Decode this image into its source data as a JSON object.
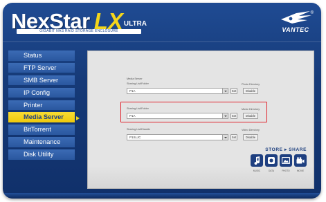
{
  "header": {
    "logo_main": "NexStar",
    "logo_lx": "LX",
    "logo_ultra": "ULTRA",
    "logo_tagline": "GIGABIT NAS RAID STORAGE ENCLOSURE",
    "brand_name": "VANTEC",
    "brand_reg": "®"
  },
  "sidebar": {
    "items": [
      {
        "label": "Status",
        "active": false
      },
      {
        "label": "FTP Server",
        "active": false
      },
      {
        "label": "SMB Server",
        "active": false
      },
      {
        "label": "IP Config",
        "active": false
      },
      {
        "label": "Printer",
        "active": false
      },
      {
        "label": "Media Server",
        "active": true
      },
      {
        "label": "BitTorrent",
        "active": false
      },
      {
        "label": "Maintenance",
        "active": false
      },
      {
        "label": "Disk Utility",
        "active": false
      }
    ]
  },
  "main": {
    "section_title": "Media Server",
    "rows": [
      {
        "share_label": "Sharing List/Folder",
        "value": "P1A",
        "set_label": "Set",
        "dir_label": "Photo Directory",
        "button_label": "Disable"
      },
      {
        "share_label": "Sharing List/Folder",
        "value": "P1A",
        "set_label": "Set",
        "dir_label": "Music Directory",
        "button_label": "Disable"
      },
      {
        "share_label": "Sharing List/Disable",
        "value": "P1SLJC",
        "set_label": "Set",
        "dir_label": "Video Directory",
        "button_label": "Disable"
      }
    ],
    "share": {
      "title": "STORE ▸ SHARE",
      "icons": [
        "music-icon",
        "camera-icon",
        "photo-icon",
        "movie-icon"
      ],
      "labels": [
        "MUSIC",
        "DATA",
        "PHOTO",
        "MOVIE"
      ]
    }
  },
  "colors": {
    "frame_blue": "#1f4b93",
    "nav_blue": "#3b6bb5",
    "active_yellow": "#f3d51b",
    "highlight_red": "#e0202a"
  }
}
